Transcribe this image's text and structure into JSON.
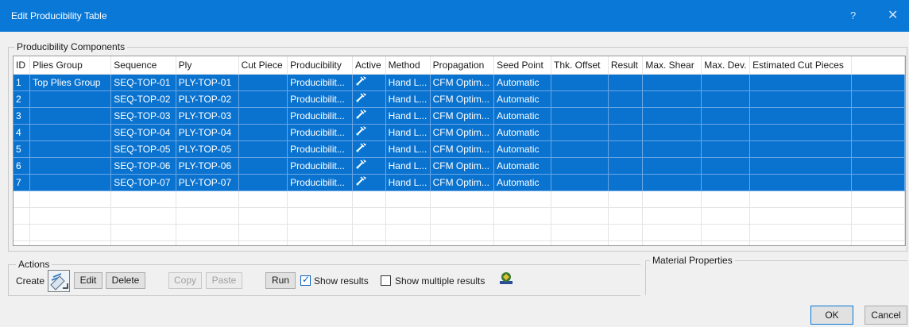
{
  "window": {
    "title": "Edit Producibility Table",
    "help_glyph": "?",
    "close_glyph": "✕"
  },
  "components_group": {
    "label": "Producibility Components"
  },
  "table": {
    "columns": [
      "ID",
      "Plies Group",
      "Sequence",
      "Ply",
      "Cut Piece",
      "Producibility",
      "Active",
      "Method",
      "Propagation",
      "Seed Point",
      "Thk. Offset",
      "Result",
      "Max. Shear",
      "Max. Dev.",
      "Estimated Cut Pieces"
    ],
    "rows": [
      {
        "id": "1",
        "plies_group": "Top Plies Group",
        "sequence": "SEQ-TOP-01",
        "ply": "PLY-TOP-01",
        "cut_piece": "",
        "producibility": "Producibilit...",
        "active_icon": "active-cursor-icon",
        "method": "Hand L...",
        "propagation": "CFM Optim...",
        "seed_point": "Automatic"
      },
      {
        "id": "2",
        "plies_group": "",
        "sequence": "SEQ-TOP-02",
        "ply": "PLY-TOP-02",
        "cut_piece": "",
        "producibility": "Producibilit...",
        "active_icon": "active-cursor-icon",
        "method": "Hand L...",
        "propagation": "CFM Optim...",
        "seed_point": "Automatic"
      },
      {
        "id": "3",
        "plies_group": "",
        "sequence": "SEQ-TOP-03",
        "ply": "PLY-TOP-03",
        "cut_piece": "",
        "producibility": "Producibilit...",
        "active_icon": "active-cursor-icon",
        "method": "Hand L...",
        "propagation": "CFM Optim...",
        "seed_point": "Automatic"
      },
      {
        "id": "4",
        "plies_group": "",
        "sequence": "SEQ-TOP-04",
        "ply": "PLY-TOP-04",
        "cut_piece": "",
        "producibility": "Producibilit...",
        "active_icon": "active-cursor-icon",
        "method": "Hand L...",
        "propagation": "CFM Optim...",
        "seed_point": "Automatic"
      },
      {
        "id": "5",
        "plies_group": "",
        "sequence": "SEQ-TOP-05",
        "ply": "PLY-TOP-05",
        "cut_piece": "",
        "producibility": "Producibilit...",
        "active_icon": "active-cursor-icon",
        "method": "Hand L...",
        "propagation": "CFM Optim...",
        "seed_point": "Automatic"
      },
      {
        "id": "6",
        "plies_group": "",
        "sequence": "SEQ-TOP-06",
        "ply": "PLY-TOP-06",
        "cut_piece": "",
        "producibility": "Producibilit...",
        "active_icon": "active-cursor-icon",
        "method": "Hand L...",
        "propagation": "CFM Optim...",
        "seed_point": "Automatic"
      },
      {
        "id": "7",
        "plies_group": "",
        "sequence": "SEQ-TOP-07",
        "ply": "PLY-TOP-07",
        "cut_piece": "",
        "producibility": "Producibilit...",
        "active_icon": "active-cursor-icon",
        "method": "Hand L...",
        "propagation": "CFM Optim...",
        "seed_point": "Automatic"
      }
    ]
  },
  "actions": {
    "label": "Actions",
    "create_label": "Create",
    "create_icon": "create-ply-icon",
    "edit_label": "Edit",
    "delete_label": "Delete",
    "copy_label": "Copy",
    "paste_label": "Paste",
    "run_label": "Run",
    "show_results_label": "Show results",
    "show_results_checked": true,
    "show_multiple_label": "Show multiple results",
    "show_multiple_checked": false,
    "multiple_results_icon": "multiple-results-icon"
  },
  "material_properties": {
    "label": "Material Properties"
  },
  "footer": {
    "ok_label": "OK",
    "cancel_label": "Cancel"
  },
  "colors": {
    "titlebar": "#0a78d7",
    "selection": "#0a73d0"
  }
}
